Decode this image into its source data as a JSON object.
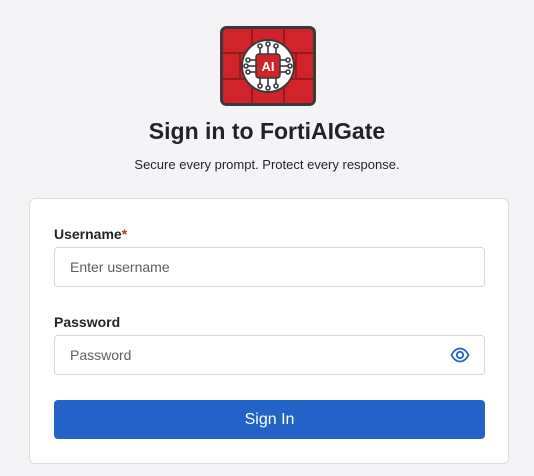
{
  "brand": {
    "logo_text": "AI",
    "title": "Sign in to FortiAIGate",
    "tagline": "Secure every prompt. Protect every response."
  },
  "form": {
    "username": {
      "label": "Username",
      "required_marker": "*",
      "placeholder": "Enter username",
      "value": ""
    },
    "password": {
      "label": "Password",
      "placeholder": "Password",
      "value": "",
      "toggle_icon": "eye-icon"
    },
    "submit_label": "Sign In"
  },
  "colors": {
    "logo_red": "#d0242a",
    "logo_border": "#3a3a3a",
    "primary_button": "#2363c8",
    "required": "#d0242a",
    "eye_icon": "#2363c8"
  }
}
